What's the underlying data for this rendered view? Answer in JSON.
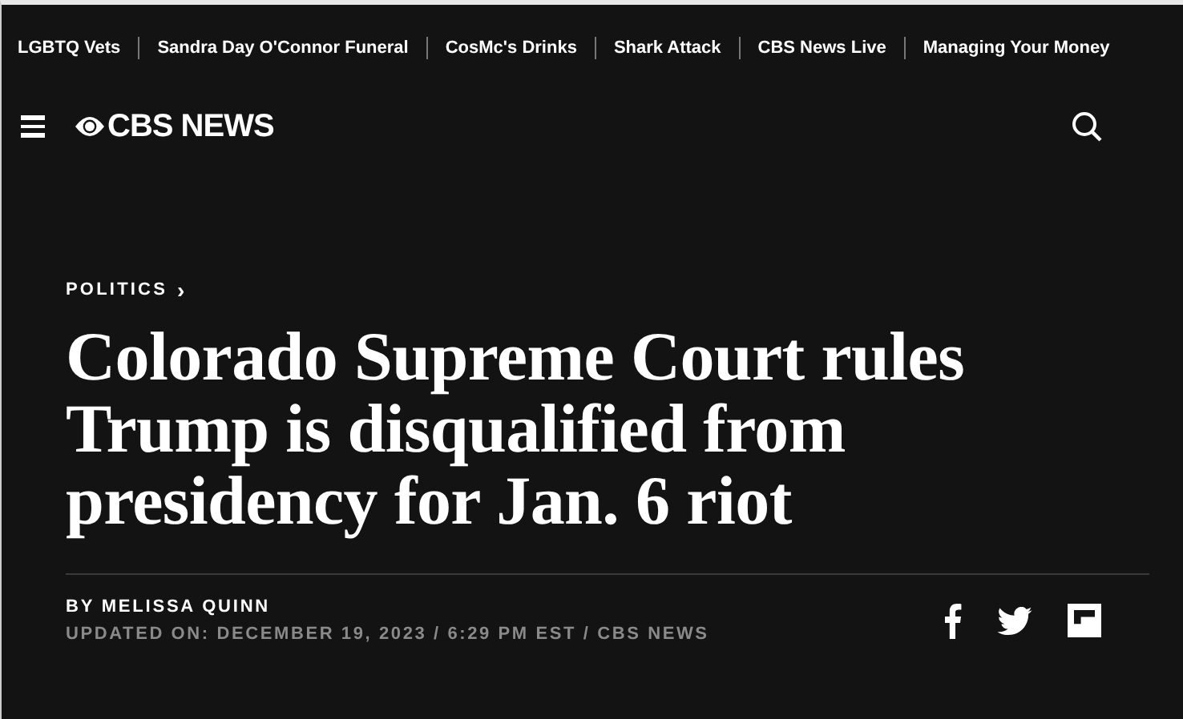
{
  "topics": [
    "LGBTQ Vets",
    "Sandra Day O'Connor Funeral",
    "CosMc's Drinks",
    "Shark Attack",
    "CBS News Live",
    "Managing Your Money"
  ],
  "header": {
    "logo": "CBS NEWS"
  },
  "article": {
    "section": "POLITICS",
    "section_arrow": "›",
    "headline": "Colorado Supreme Court rules Trump is disqualified from presidency for Jan. 6 riot",
    "byline": "BY MELISSA QUINN",
    "updated": "UPDATED ON: DECEMBER 19, 2023 / 6:29 PM EST / CBS NEWS"
  }
}
